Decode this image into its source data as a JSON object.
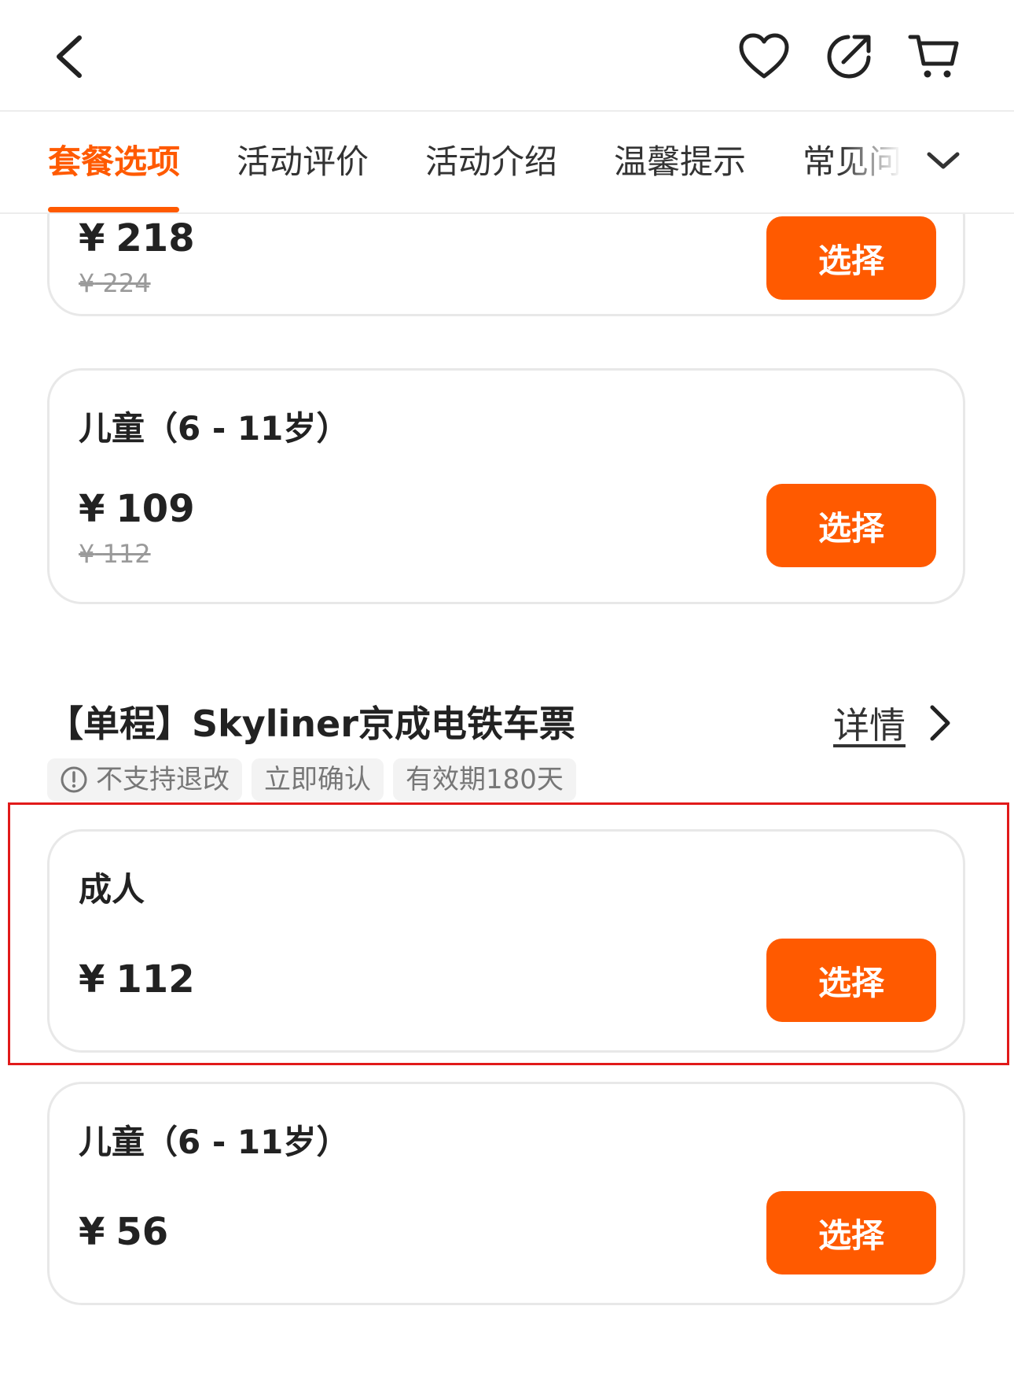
{
  "header": {
    "back_icon": "chevron-left-icon",
    "actions": [
      "heart-icon",
      "share-icon",
      "cart-icon"
    ]
  },
  "tabs": {
    "items": [
      {
        "label": "套餐选项",
        "active": true
      },
      {
        "label": "活动评价",
        "active": false
      },
      {
        "label": "活动介绍",
        "active": false
      },
      {
        "label": "温馨提示",
        "active": false
      },
      {
        "label": "常见问",
        "active": false
      }
    ],
    "more_icon": "chevron-down-icon"
  },
  "package_1": {
    "cards": [
      {
        "price_currency": "¥",
        "price": "218",
        "original_currency": "¥",
        "original_price": "224",
        "button": "选择"
      },
      {
        "label": "儿童（6 - 11岁）",
        "price_currency": "¥",
        "price": "109",
        "original_currency": "¥",
        "original_price": "112",
        "button": "选择"
      }
    ]
  },
  "package_2": {
    "title": "【单程】Skyliner京成电铁车票",
    "details_label": "详情",
    "tags": [
      "不支持退改",
      "立即确认",
      "有效期180天"
    ],
    "cards": [
      {
        "label": "成人",
        "price_currency": "¥",
        "price": "112",
        "button": "选择"
      },
      {
        "label": "儿童（6 - 11岁）",
        "price_currency": "¥",
        "price": "56",
        "button": "选择"
      }
    ]
  },
  "colors": {
    "accent": "#ff5a00",
    "highlight": "#e11a1a",
    "border": "#e8e8e8"
  }
}
